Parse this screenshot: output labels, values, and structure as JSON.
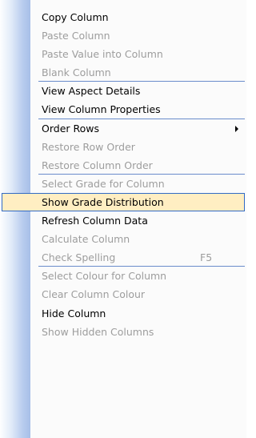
{
  "menu": {
    "items": [
      {
        "label": "Copy Column",
        "enabled": true
      },
      {
        "label": "Paste Column",
        "enabled": false
      },
      {
        "label": "Paste Value into Column",
        "enabled": false
      },
      {
        "label": "Blank Column",
        "enabled": false
      },
      {
        "label": "View Aspect Details",
        "enabled": true
      },
      {
        "label": "View Column Properties",
        "enabled": true
      },
      {
        "label": "Order Rows",
        "enabled": true,
        "submenu": true
      },
      {
        "label": "Restore Row Order",
        "enabled": false
      },
      {
        "label": "Restore Column Order",
        "enabled": false
      },
      {
        "label": "Select Grade for Column",
        "enabled": false
      },
      {
        "label": "Show Grade Distribution",
        "enabled": true,
        "highlighted": true
      },
      {
        "label": "Refresh Column Data",
        "enabled": true
      },
      {
        "label": "Calculate Column",
        "enabled": false
      },
      {
        "label": "Check Spelling",
        "enabled": false,
        "shortcut": "F5"
      },
      {
        "label": "Select Colour for Column",
        "enabled": false
      },
      {
        "label": "Clear Column Colour",
        "enabled": false
      },
      {
        "label": "Hide Column",
        "enabled": true
      },
      {
        "label": "Show Hidden Columns",
        "enabled": false
      }
    ]
  },
  "colors": {
    "highlight_fill": "#ffeec2",
    "highlight_border": "#316ac5",
    "separator": "#6a8ccb",
    "disabled_text": "#9d9d9d",
    "gutter": "#a7bfe8"
  },
  "icons": {
    "submenu_arrow": "submenu-arrow-icon"
  }
}
